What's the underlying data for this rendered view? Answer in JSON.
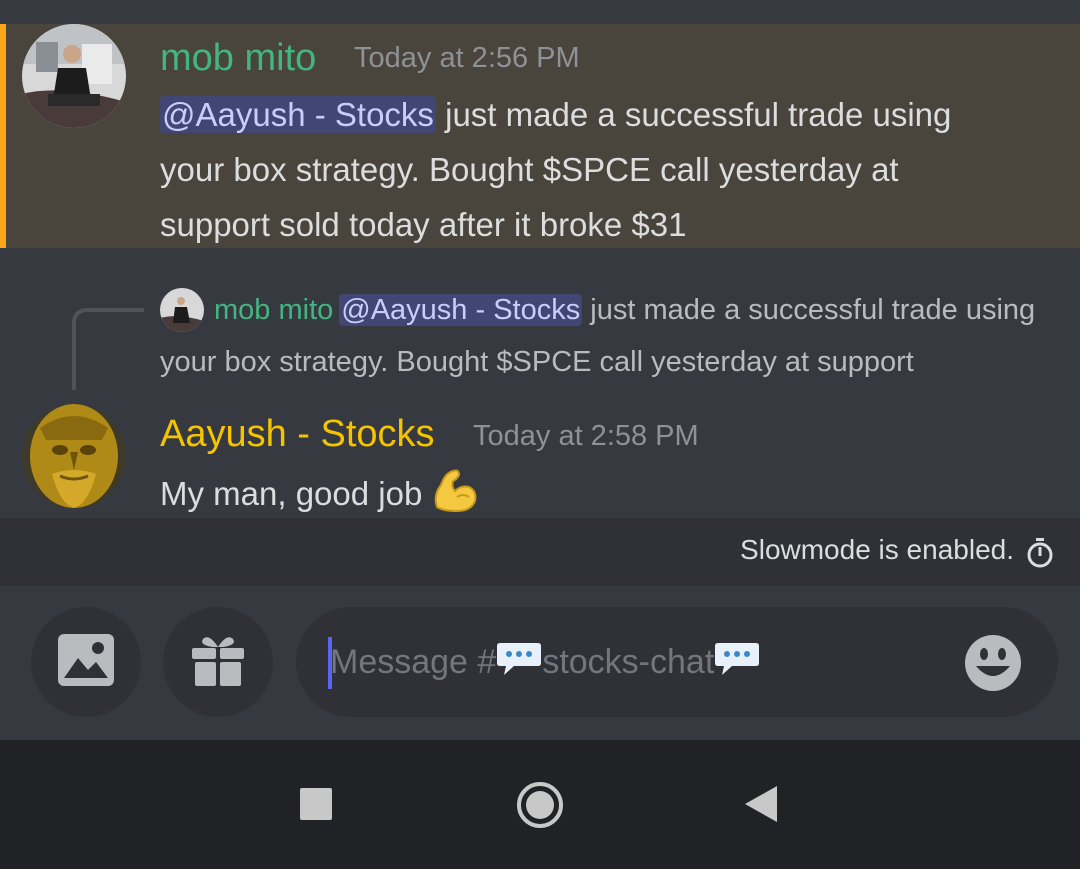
{
  "messages": {
    "first": {
      "author": "mob mito",
      "timestamp": "Today at 2:56 PM",
      "mention": "@Aayush - Stocks",
      "text_line1": " just made a successful trade using",
      "text_line2": "your box strategy. Bought $SPCE call yesterday at",
      "text_line3": "support sold today after it broke $31"
    },
    "reply_preview": {
      "author": "mob mito",
      "mention": "@Aayush - Stocks",
      "text": " just made a successful trade using your box strategy. Bought $SPCE call yesterday at support"
    },
    "second": {
      "author": "Aayush - Stocks",
      "timestamp": "Today at 2:58 PM",
      "text": "My man, good job ",
      "emoji": "flexed-biceps"
    }
  },
  "slowmode": {
    "text": "Slowmode is enabled."
  },
  "composer": {
    "placeholder_prefix": "Message #",
    "channel_name": "stocks-chat"
  },
  "colors": {
    "mob_mito": "#43b581",
    "aayush": "#f5c400",
    "mention_bar": "#faa61a",
    "mention_bg": "#414675"
  },
  "icons": [
    "image-icon",
    "gift-icon",
    "emoji-icon",
    "timer-icon",
    "speech-bubble-icon",
    "nav-recents-icon",
    "nav-home-icon",
    "nav-back-icon"
  ]
}
